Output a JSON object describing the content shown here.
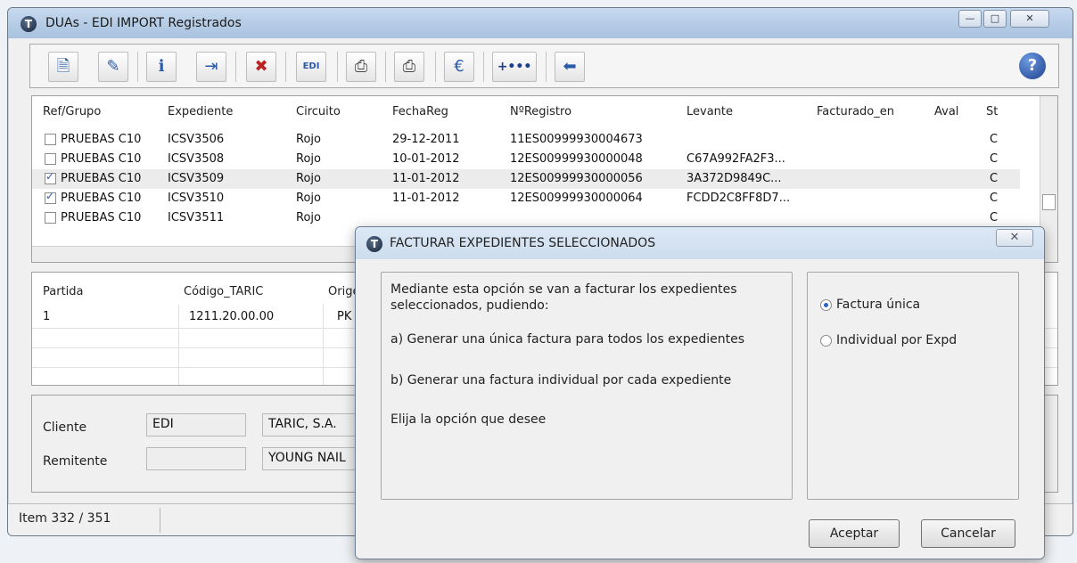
{
  "window": {
    "title": "DUAs  - EDI IMPORT Registrados",
    "app_icon": "T",
    "controls": {
      "minimize": "—",
      "maximize": "□",
      "close": "✕"
    }
  },
  "toolbar": {
    "buttons": [
      {
        "name": "new-doc-icon",
        "glyph": "🗎"
      },
      {
        "name": "edit-doc-icon",
        "glyph": "✎"
      },
      {
        "name": "info-icon",
        "glyph": "ℹ"
      },
      {
        "name": "import-icon",
        "glyph": "⇥"
      },
      {
        "name": "delete-doc-icon",
        "glyph": "✖"
      },
      {
        "name": "edi-icon",
        "glyph": "EDI"
      },
      {
        "name": "print-icon",
        "glyph": "⎙"
      },
      {
        "name": "print-preview-icon",
        "glyph": "⎙"
      },
      {
        "name": "invoice-euro-icon",
        "glyph": "€"
      },
      {
        "name": "more-icon",
        "glyph": "+•••"
      },
      {
        "name": "back-arrow-icon",
        "glyph": "⬅"
      }
    ],
    "help": "?"
  },
  "grid": {
    "columns": [
      "Ref/Grupo",
      "Expediente",
      "Circuito",
      "FechaReg",
      "NºRegistro",
      "Levante",
      "Facturado_en",
      "Aval",
      "St"
    ],
    "rows": [
      {
        "checked": false,
        "ref": "PRUEBAS C10",
        "expediente": "ICSV3506",
        "circuito": "Rojo",
        "fecha": "29-12-2011",
        "registro": "11ES00999930004673",
        "levante": "",
        "st": "C"
      },
      {
        "checked": false,
        "ref": "PRUEBAS C10",
        "expediente": "ICSV3508",
        "circuito": "Rojo",
        "fecha": "10-01-2012",
        "registro": "12ES00999930000048",
        "levante": "C67A992FA2F3...",
        "st": "C"
      },
      {
        "checked": true,
        "ref": "PRUEBAS C10",
        "expediente": "ICSV3509",
        "circuito": "Rojo",
        "fecha": "11-01-2012",
        "registro": "12ES00999930000056",
        "levante": "3A372D9849C...",
        "st": "C"
      },
      {
        "checked": true,
        "ref": "PRUEBAS C10",
        "expediente": "ICSV3510",
        "circuito": "Rojo",
        "fecha": "11-01-2012",
        "registro": "12ES00999930000064",
        "levante": "FCDD2C8FF8D7...",
        "st": "C"
      },
      {
        "checked": false,
        "ref": "PRUEBAS C10",
        "expediente": "ICSV3511",
        "circuito": "Rojo",
        "fecha": "",
        "registro": "",
        "levante": "",
        "st": "C"
      }
    ]
  },
  "partidas": {
    "columns": [
      "Partida",
      "Código_TARIC",
      "Orige"
    ],
    "rows": [
      {
        "partida": "1",
        "taric": "1211.20.00.00",
        "origen": "PK"
      }
    ]
  },
  "details": {
    "cliente_label": "Cliente",
    "cliente_code": "EDI",
    "cliente_name": "TARIC, S.A.",
    "remitente_label": "Remitente",
    "remitente_code": "",
    "remitente_name": "YOUNG NAIL"
  },
  "status": {
    "item": "Item 332 / 351"
  },
  "dialog": {
    "title": "FACTURAR EXPEDIENTES SELECCIONADOS",
    "close": "✕",
    "line1": "Mediante esta opción se van a facturar los expedientes",
    "line2": "seleccionados, pudiendo:",
    "option_a": "a) Generar una única factura para todos los expedientes",
    "option_b": "b) Generar una factura individual por cada expediente",
    "prompt": "Elija la opción que desee",
    "radio_unica": "Factura única",
    "radio_individual": "Individual por Expd",
    "selected": "unica",
    "accept": "Aceptar",
    "cancel": "Cancelar"
  }
}
